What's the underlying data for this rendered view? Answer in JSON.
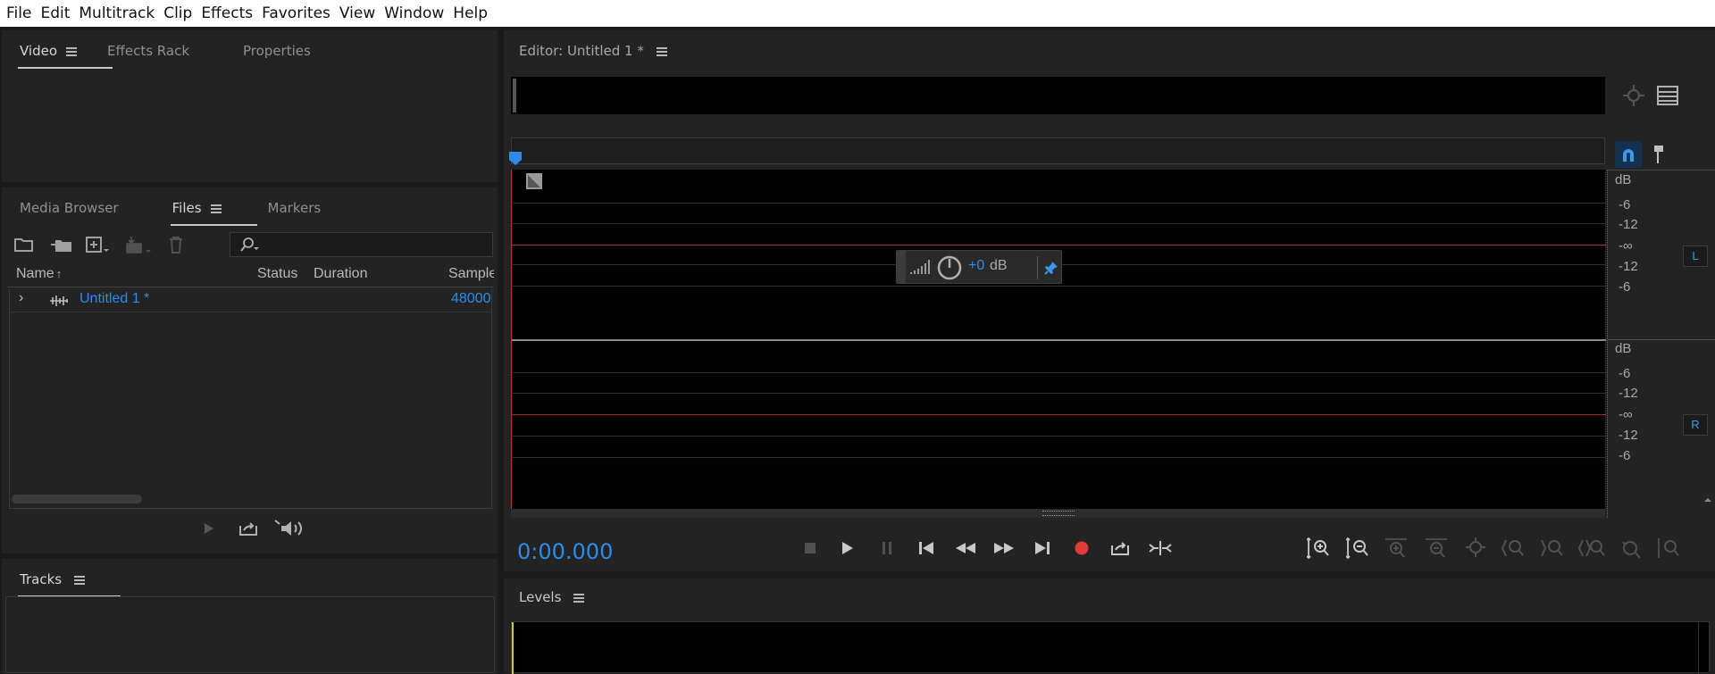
{
  "menu": [
    "File",
    "Edit",
    "Multitrack",
    "Clip",
    "Effects",
    "Favorites",
    "View",
    "Window",
    "Help"
  ],
  "top_left_panel": {
    "tabs": [
      "Video",
      "Effects Rack",
      "Properties"
    ],
    "active": "Video"
  },
  "files_panel": {
    "tabs": [
      "Media Browser",
      "Files",
      "Markers"
    ],
    "active": "Files",
    "search_placeholder": "",
    "columns": [
      "Name",
      "Status",
      "Duration",
      "Sample"
    ],
    "rows": [
      {
        "name": "Untitled 1 *",
        "status": "",
        "duration": "",
        "sample": "48000"
      }
    ]
  },
  "tracks_panel": {
    "title": "Tracks"
  },
  "editor": {
    "title": "Editor: Untitled 1 *",
    "volume_value": "+0",
    "volume_unit": "dB",
    "time": "0:00.000",
    "channel_L": "L",
    "channel_R": "R",
    "db_scale_top": [
      "dB",
      "-6",
      "-12",
      "-∞",
      "-12",
      "-6"
    ],
    "db_scale_bottom": [
      "dB",
      "-6",
      "-12",
      "-∞",
      "-12",
      "-6"
    ]
  },
  "levels_panel": {
    "title": "Levels"
  },
  "colors": {
    "accent": "#2d8ceb",
    "record": "#e03a3a",
    "center_line": "#c0302f",
    "grid": "#1f3a24"
  }
}
